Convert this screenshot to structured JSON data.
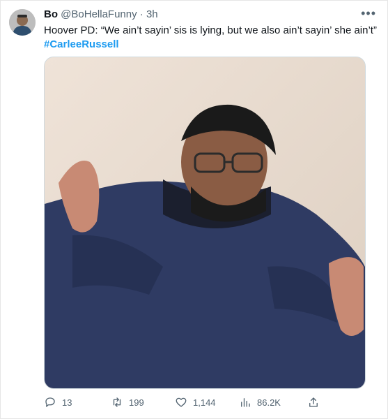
{
  "tweet": {
    "display_name": "Bo",
    "handle": "@BoHellaFunny",
    "separator": "·",
    "time": "3h",
    "text": "Hoover PD: “We ain’t sayin’ sis is lying, but we also ain’t sayin’ she ain’t”",
    "hashtag": "#CarleeRussell"
  },
  "icons": {
    "more": "more-icon",
    "reply": "reply-icon",
    "retweet": "retweet-icon",
    "like": "like-icon",
    "views": "views-icon",
    "share": "share-icon"
  },
  "metrics": {
    "replies": "13",
    "retweets": "199",
    "likes": "1,144",
    "views": "86.2K"
  },
  "colors": {
    "link": "#1d9bf0",
    "muted": "#536471",
    "text": "#0f1419",
    "border": "#cfd9de"
  }
}
